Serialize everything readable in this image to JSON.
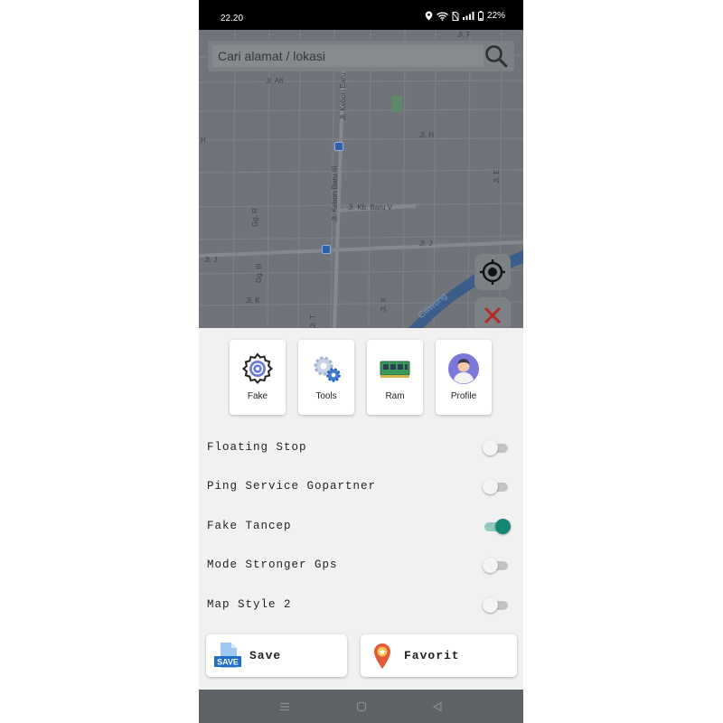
{
  "status_bar": {
    "time": "22.20",
    "battery": "22%"
  },
  "search": {
    "placeholder": "Cari alamat / lokasi"
  },
  "map": {
    "streets": [
      "Jl. A6",
      "Jl. Kebon Baru",
      "Jl. H",
      "Jl. Kebon Baru III",
      "Jl. Kb. Baru V",
      "Jl. J",
      "Jl. K",
      "Jl. X",
      "Jl. T",
      "Gg. R",
      "Gg. III",
      "Jl. E",
      "Jl. F",
      "H",
      "Ciliwung"
    ]
  },
  "tiles": [
    {
      "label": "Fake",
      "icon": "gear-pin-icon"
    },
    {
      "label": "Tools",
      "icon": "gears-icon"
    },
    {
      "label": "Ram",
      "icon": "ram-chip-icon"
    },
    {
      "label": "Profile",
      "icon": "avatar-icon"
    }
  ],
  "settings": [
    {
      "label": "Floating Stop",
      "on": false
    },
    {
      "label": "Ping Service Gopartner",
      "on": false
    },
    {
      "label": "Fake Tancep",
      "on": true
    },
    {
      "label": "Mode Stronger Gps",
      "on": false
    },
    {
      "label": "Map Style 2",
      "on": false
    }
  ],
  "actions": {
    "save_label": "Save",
    "save_icon_text": "SAVE",
    "favorit_label": "Favorit"
  },
  "colors": {
    "accent": "#158675",
    "accent_track": "#8fc9bf",
    "map": "#6f7378",
    "nav": "#5e6266"
  }
}
